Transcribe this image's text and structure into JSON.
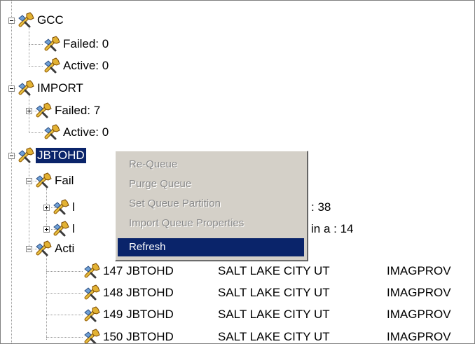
{
  "tree": {
    "rows": [
      {
        "label": "GCC"
      },
      {
        "label": "Failed: 0"
      },
      {
        "label": "Active: 0"
      },
      {
        "label": "IMPORT"
      },
      {
        "label": "Failed: 7"
      },
      {
        "label": "Active: 0"
      },
      {
        "label": "JBTOHD"
      },
      {
        "label": "Fail"
      },
      {
        "label": "l"
      },
      {
        "label": "l"
      },
      {
        "label": "Acti"
      }
    ],
    "partial_right": [
      ": 38",
      "in a : 14"
    ],
    "table_rows": [
      {
        "id": "147 JBTOHD",
        "city": "SALT LAKE CITY UT",
        "source": "IMAGPROV"
      },
      {
        "id": "148 JBTOHD",
        "city": "SALT LAKE CITY UT",
        "source": "IMAGPROV"
      },
      {
        "id": "149 JBTOHD",
        "city": "SALT LAKE CITY UT",
        "source": "IMAGPROV"
      },
      {
        "id": "150 JBTOHD",
        "city": "SALT LAKE CITY UT",
        "source": "IMAGPROV"
      }
    ],
    "icon_name": "wrench-icon"
  },
  "context_menu": {
    "items": [
      {
        "label": "Re-Queue",
        "enabled": false
      },
      {
        "label": "Purge Queue",
        "enabled": false
      },
      {
        "label": "Set Queue Partition",
        "enabled": false
      },
      {
        "label": "Import Queue Properties",
        "enabled": false
      },
      {
        "label": "Refresh",
        "enabled": true
      }
    ]
  },
  "colors": {
    "selection": "#0a246a",
    "menu_bg": "#d4d0c8"
  }
}
